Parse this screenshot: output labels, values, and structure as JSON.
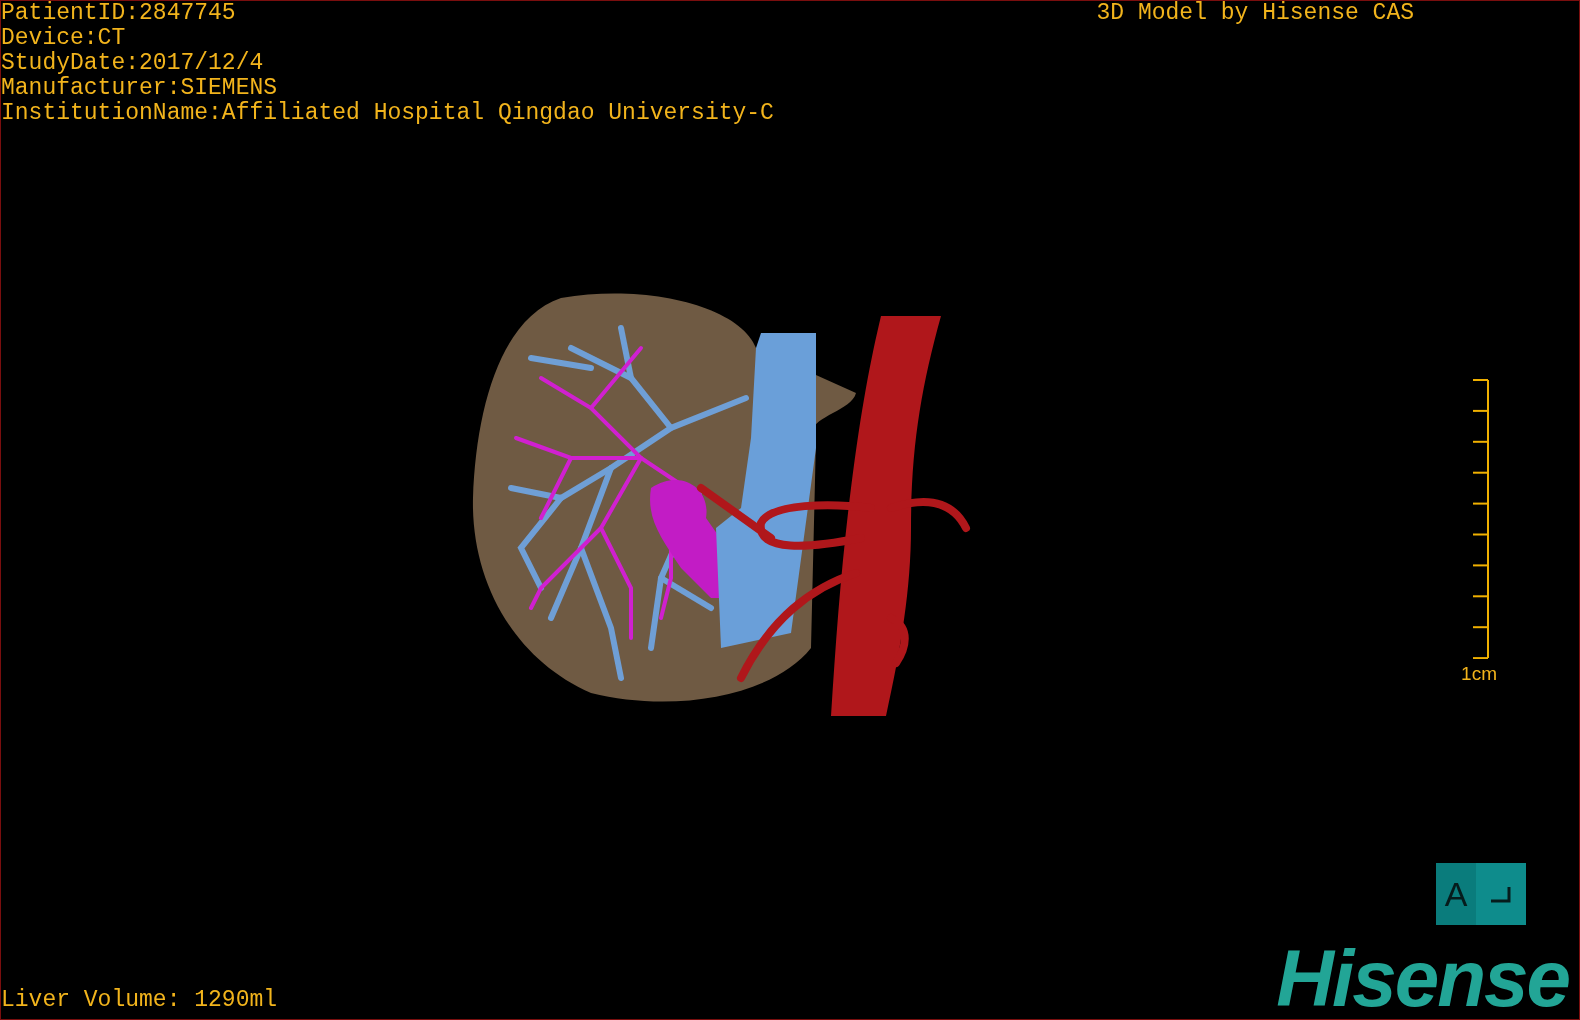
{
  "overlay": {
    "patient_info": [
      "PatientID:2847745",
      "Device:CT",
      "StudyDate:2017/12/4",
      "Manufacturer:SIEMENS",
      "InstitutionName:Affiliated Hospital Qingdao University-C"
    ],
    "model_credit": "3D Model by Hisense CAS",
    "liver_volume": "Liver Volume: 1290ml"
  },
  "scale_bar": {
    "label": "1cm"
  },
  "orientation_cube": {
    "face_label": "A"
  },
  "logo": {
    "text": "Hisense"
  }
}
